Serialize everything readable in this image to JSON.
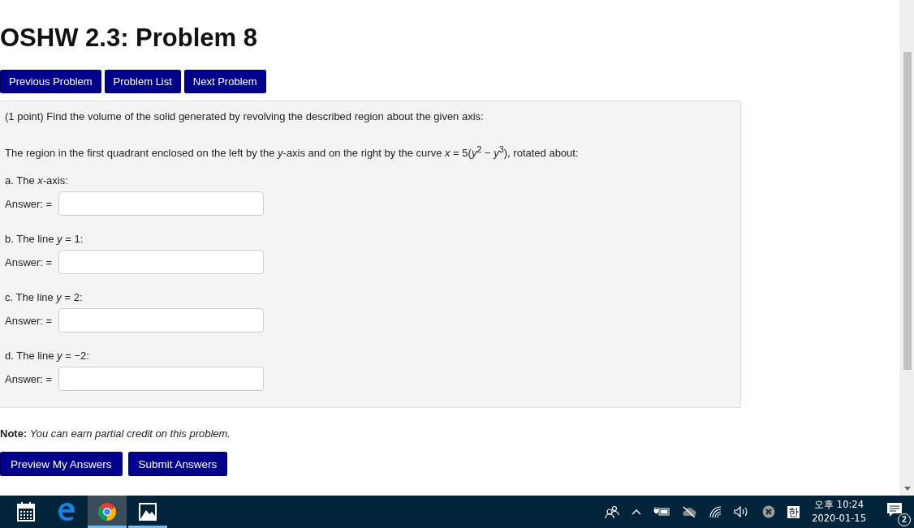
{
  "title": "OSHW 2.3: Problem 8",
  "nav_buttons": [
    "Previous Problem",
    "Problem List",
    "Next Problem"
  ],
  "problem": {
    "intro": "(1 point) Find the volume of the solid generated by revolving the described region about the given axis:",
    "statement": "The region in the first quadrant enclosed on the left by the *y*-axis and on the right by the curve *x* = 5(*y*$^{2}$ − *y*$^{3}$), rotated about:",
    "parts": [
      {
        "label": "a. The *x*-axis:",
        "answer_label": "Answer: ="
      },
      {
        "label": "b. The line *y* = 1:",
        "answer_label": "Answer: ="
      },
      {
        "label": "c. The line *y* = 2:",
        "answer_label": "Answer: ="
      },
      {
        "label": "d. The line *y* = −2:",
        "answer_label": "Answer: ="
      }
    ]
  },
  "note": {
    "label": "Note:",
    "text": "You can earn partial credit on this problem."
  },
  "submit_buttons": [
    "Preview My Answers",
    "Submit Answers"
  ],
  "taskbar": {
    "apps": [
      {
        "kind": "calendar",
        "selected": false,
        "running": false
      },
      {
        "kind": "edge",
        "selected": false,
        "running": false
      },
      {
        "kind": "chrome",
        "selected": true,
        "running": true
      },
      {
        "kind": "photos",
        "selected": false,
        "running": true
      }
    ],
    "ime": "한",
    "time": "오후 10:24",
    "date": "2020-01-15",
    "notifications": "2"
  }
}
